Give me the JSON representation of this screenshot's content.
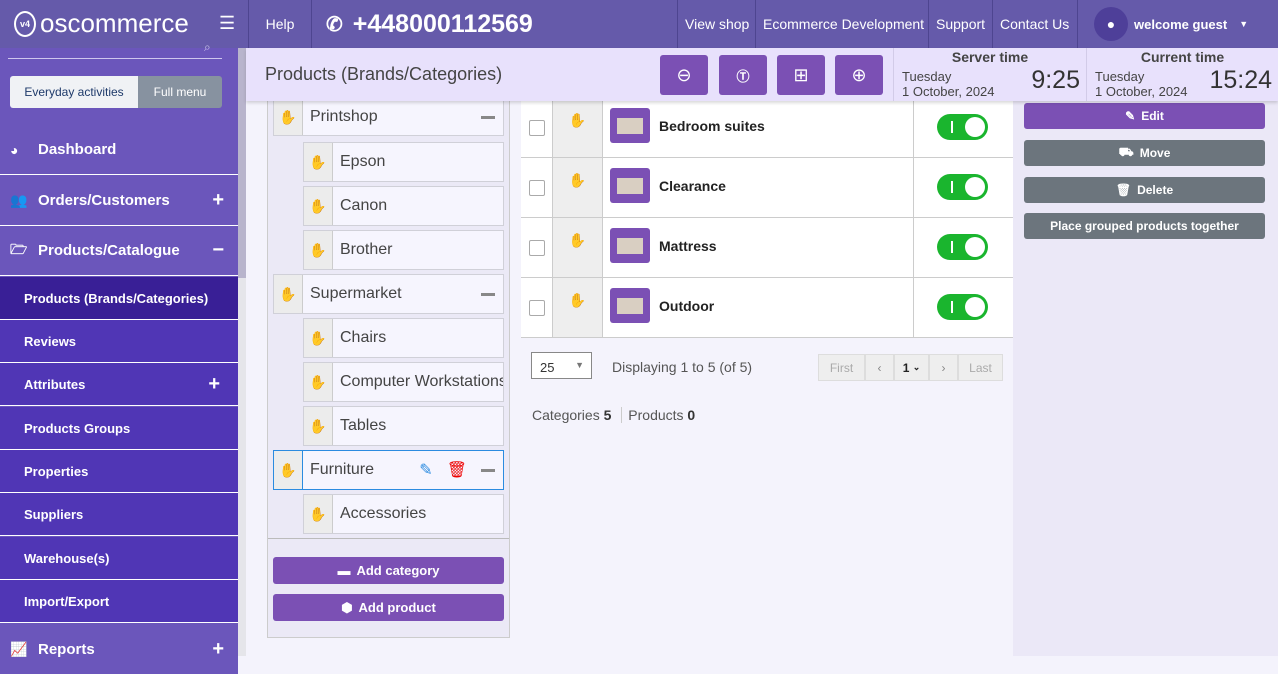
{
  "topbar": {
    "logo": "oscommerce",
    "logo_badge": "v4",
    "help": "Help",
    "phone": "+448000112569",
    "links": [
      "View shop",
      "Ecommerce Development",
      "Support",
      "Contact Us"
    ],
    "user": "welcome guest"
  },
  "sidebar": {
    "toggle": [
      "Everyday activities",
      "Full menu"
    ],
    "items": [
      {
        "label": "Dashboard",
        "icon": "dashboard-icon"
      },
      {
        "label": "Orders/Customers",
        "icon": "users-icon"
      },
      {
        "label": "Products/Catalogue",
        "icon": "folder-open-icon"
      }
    ],
    "sub": [
      "Products (Brands/Categories)",
      "Reviews",
      "Attributes",
      "Products Groups",
      "Properties",
      "Suppliers",
      "Warehouse(s)",
      "Import/Export"
    ],
    "reports": "Reports"
  },
  "header": {
    "title": "Products (Brands/Categories)",
    "server": {
      "label": "Server time",
      "day": "Tuesday",
      "date": "1 October, 2024",
      "time": "9:25"
    },
    "current": {
      "label": "Current time",
      "day": "Tuesday",
      "date": "1 October, 2024",
      "time": "15:24"
    }
  },
  "tree": {
    "nodes": [
      {
        "label": "Printshop",
        "level": 0
      },
      {
        "label": "Epson",
        "level": 1
      },
      {
        "label": "Canon",
        "level": 1
      },
      {
        "label": "Brother",
        "level": 1
      },
      {
        "label": "Supermarket",
        "level": 0
      },
      {
        "label": "Chairs",
        "level": 1
      },
      {
        "label": "Computer Workstations",
        "level": 1
      },
      {
        "label": "Tables",
        "level": 1
      },
      {
        "label": "Furniture",
        "level": 0,
        "selected": true
      },
      {
        "label": "Accessories",
        "level": 1
      }
    ],
    "add_category": "Add category",
    "add_product": "Add product"
  },
  "table": {
    "rows": [
      {
        "name": "Bedroom suites",
        "active": true
      },
      {
        "name": "Clearance",
        "active": true
      },
      {
        "name": "Mattress",
        "active": true
      },
      {
        "name": "Outdoor",
        "active": true
      }
    ],
    "per_page": "25",
    "displaying": "Displaying 1 to 5 (of 5)",
    "first": "First",
    "page": "1",
    "last": "Last",
    "categories_label": "Categories",
    "categories_count": "5",
    "products_label": "Products",
    "products_count": "0"
  },
  "actions": {
    "edit": "Edit",
    "move": "Move",
    "delete": "Delete",
    "group": "Place grouped products together"
  },
  "colors": {
    "topbar": "#655aaa",
    "accent": "#7b50b4",
    "toggle_on": "#1ab52e"
  }
}
